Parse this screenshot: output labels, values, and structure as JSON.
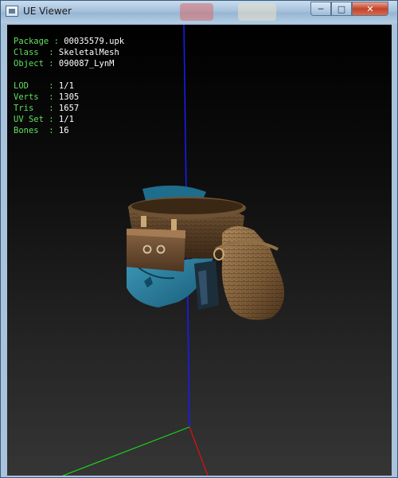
{
  "window": {
    "title": "UE Viewer",
    "controls": {
      "minimize_icon": "minimize-icon",
      "maximize_icon": "maximize-icon",
      "close_icon": "close-icon"
    }
  },
  "info": {
    "group1": [
      {
        "label": "Package",
        "value": "00035579.upk"
      },
      {
        "label": "Class  ",
        "value": "SkeletalMesh"
      },
      {
        "label": "Object ",
        "value": "090087_LynM"
      }
    ],
    "group2": [
      {
        "label": "LOD    ",
        "value": "1/1"
      },
      {
        "label": "Verts  ",
        "value": "1305"
      },
      {
        "label": "Tris   ",
        "value": "1657"
      },
      {
        "label": "UV Set ",
        "value": "1/1"
      },
      {
        "label": "Bones  ",
        "value": "16"
      }
    ]
  },
  "colors": {
    "axis_x": "#ff0000",
    "axis_y": "#00ff00",
    "axis_z": "#0000ff",
    "info_label": "#5fe05f",
    "info_value": "#ffffff"
  }
}
